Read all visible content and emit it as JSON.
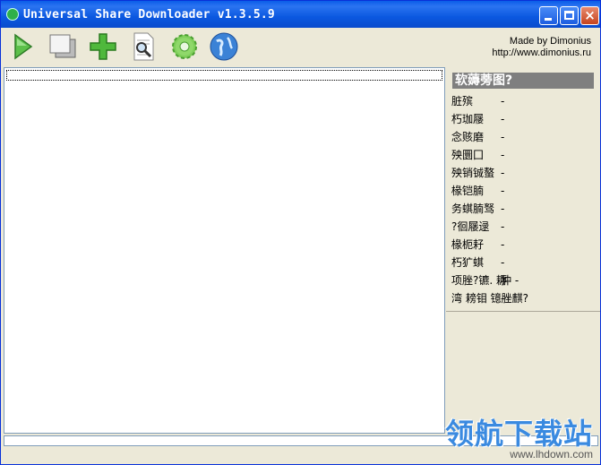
{
  "window": {
    "title": "Universal Share Downloader v1.3.5.9",
    "controls": {
      "minimize": "minimize",
      "maximize": "maximize",
      "close": "×"
    }
  },
  "toolbar": {
    "buttons": [
      {
        "icon": "play-icon"
      },
      {
        "icon": "copy-windows-icon"
      },
      {
        "icon": "add-plus-icon"
      },
      {
        "icon": "search-document-icon"
      },
      {
        "icon": "gear-icon"
      },
      {
        "icon": "globe-icon"
      }
    ],
    "credits_line1": "Made by Dimonius",
    "credits_line2": "http://www.dimonius.ru"
  },
  "sidepanel": {
    "header": "软薅蒡图?",
    "items": [
      {
        "label": "脏殡",
        "value": "-"
      },
      {
        "label": "朽珈屦",
        "value": "-"
      },
      {
        "label": "念赅磨",
        "value": "-"
      },
      {
        "label": "殃圜囗",
        "value": "-"
      },
      {
        "label": "殃销铖螯",
        "value": "-"
      },
      {
        "label": "椽铠腩",
        "value": "-"
      },
      {
        "label": "务蜞腩驽",
        "value": "-"
      },
      {
        "label": "?徊屦逯",
        "value": "-"
      },
      {
        "label": "椽枙耔",
        "value": "-"
      },
      {
        "label": "朽犷蜞",
        "value": "-"
      },
      {
        "label": "项脞?镳. 耨",
        "value": "狆 -"
      },
      {
        "label": "湾 耪钼 镱脞麒?",
        "value": "-"
      }
    ]
  },
  "watermark": {
    "main": "领航下载站",
    "url": "www.lhdown.com"
  },
  "colors": {
    "titlebar": "#0a5de8",
    "face": "#ece9d8",
    "side_header": "#7f7f7f",
    "watermark": "#3a8ae0"
  }
}
